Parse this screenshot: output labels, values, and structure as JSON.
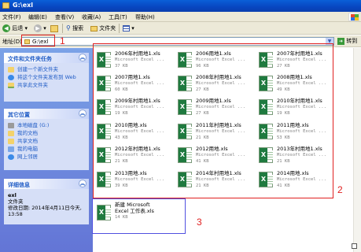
{
  "window": {
    "title": "G:\\exl"
  },
  "menubar": {
    "items": [
      "文件(F)",
      "编辑(E)",
      "查看(V)",
      "收藏(A)",
      "工具(T)",
      "帮助(H)"
    ]
  },
  "toolbar": {
    "back": "后退",
    "search": "搜索",
    "folders": "文件夹"
  },
  "address": {
    "label": "地址(D)",
    "value": "G:\\exl",
    "go": "转到"
  },
  "taskpane": {
    "file_tasks": {
      "title": "文件和文件夹任务",
      "items": [
        "创建一个新文件夹",
        "将这个文件夹发布到 Web",
        "共享此文件夹"
      ]
    },
    "other_places": {
      "title": "其它位置",
      "items": [
        "本地磁盘 (G:)",
        "我的文档",
        "共享文档",
        "我的电脑",
        "网上邻居"
      ]
    },
    "details": {
      "title": "详细信息",
      "name": "exl",
      "type": "文件夹",
      "modified_label": "修改日期:",
      "modified": "2014年4月11日今天, 13:58"
    }
  },
  "files": [
    {
      "name": "2006年村用地1.xls",
      "type": "Microsoft Excel ...",
      "size": "37 KB"
    },
    {
      "name": "2006用地1.xls",
      "type": "Microsoft Excel ...",
      "size": "96 KB"
    },
    {
      "name": "2007年村用地1.xls",
      "type": "Microsoft Excel ...",
      "size": "27 KB"
    },
    {
      "name": "2007用地1.xls",
      "type": "Microsoft Excel ...",
      "size": "60 KB"
    },
    {
      "name": "2008年村用地1.xls",
      "type": "Microsoft Excel ...",
      "size": "27 KB"
    },
    {
      "name": "2008用地1.xls",
      "type": "Microsoft Excel ...",
      "size": "49 KB"
    },
    {
      "name": "2009年村用地1.xls",
      "type": "Microsoft Excel ...",
      "size": "19 KB"
    },
    {
      "name": "2009用地1.xls",
      "type": "Microsoft Excel ...",
      "size": "27 KB"
    },
    {
      "name": "2010年村用地1.xls",
      "type": "Microsoft Excel ...",
      "size": "19 KB"
    },
    {
      "name": "2010用地.xls",
      "type": "Microsoft Excel ...",
      "size": "43 KB"
    },
    {
      "name": "2011年村用地1.xls",
      "type": "Microsoft Excel ...",
      "size": "21 KB"
    },
    {
      "name": "2011用地.xls",
      "type": "Microsoft Excel ...",
      "size": "53 KB"
    },
    {
      "name": "2012年村用地1.xls",
      "type": "Microsoft Excel ...",
      "size": "21 KB"
    },
    {
      "name": "2012用地.xls",
      "type": "Microsoft Excel ...",
      "size": "41 KB"
    },
    {
      "name": "2013年村用地1.xls",
      "type": "Microsoft Excel ...",
      "size": "21 KB"
    },
    {
      "name": "2013用地.xls",
      "type": "Microsoft Excel ...",
      "size": "39 KB"
    },
    {
      "name": "2014年村用地1.xls",
      "type": "Microsoft Excel ...",
      "size": "21 KB"
    },
    {
      "name": "2014用地.xls",
      "type": "Microsoft Excel ...",
      "size": "41 KB"
    }
  ],
  "new_file": {
    "name1": "新建 Microsoft",
    "name2": "Excel 工作表.xls",
    "size": "14 KB"
  },
  "annotations": {
    "n1": "1",
    "n2": "2",
    "n3": "3",
    "color_red": "#e02020",
    "color_blue": "#5050e0"
  }
}
